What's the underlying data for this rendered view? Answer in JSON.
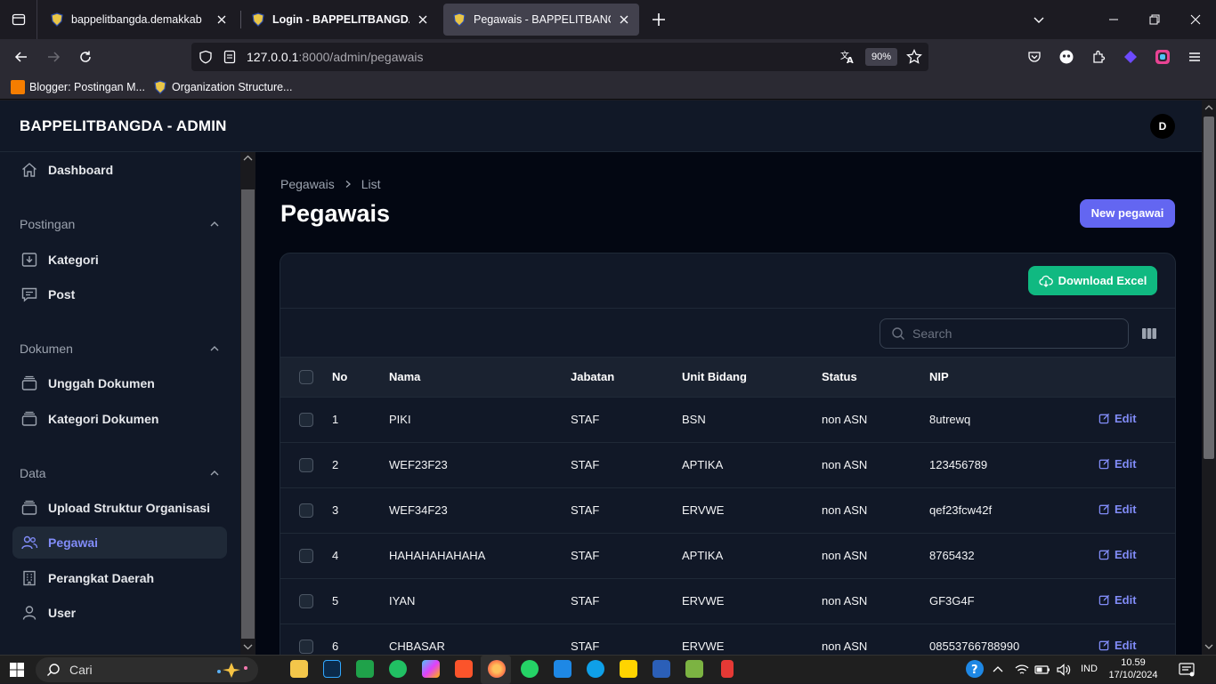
{
  "browser": {
    "tabs": [
      {
        "label": "bappelitbangda.demakkab",
        "active": false
      },
      {
        "label": "Login - BAPPELITBANGDA - AI",
        "active": false
      },
      {
        "label": "Pegawais - BAPPELITBANGDA -",
        "active": true
      }
    ],
    "url_host": "127.0.0.1",
    "url_rest": ":8000/admin/pegawais",
    "zoom": "90%",
    "bookmarks": [
      "Blogger: Postingan M...",
      "Organization Structure..."
    ]
  },
  "app": {
    "brand": "BAPPELITBANGDA - ADMIN",
    "avatar_initial": "D",
    "sidebar": {
      "dashboard": "Dashboard",
      "groups": [
        {
          "label": "Postingan",
          "items": [
            "Kategori",
            "Post"
          ]
        },
        {
          "label": "Dokumen",
          "items": [
            "Unggah Dokumen",
            "Kategori Dokumen"
          ]
        },
        {
          "label": "Data",
          "items": [
            "Upload Struktur Organisasi",
            "Pegawai",
            "Perangkat Daerah",
            "User"
          ]
        }
      ],
      "active_item": "Pegawai"
    },
    "breadcrumb": {
      "parent": "Pegawais",
      "current": "List"
    },
    "title": "Pegawais",
    "new_button": "New pegawai",
    "download_button": "Download Excel",
    "search_placeholder": "Search",
    "table": {
      "columns": [
        "No",
        "Nama",
        "Jabatan",
        "Unit Bidang",
        "Status",
        "NIP"
      ],
      "edit_label": "Edit",
      "rows": [
        {
          "no": "1",
          "nama": "PIKI",
          "jabatan": "STAF",
          "unit": "BSN",
          "status": "non ASN",
          "nip": "8utrewq"
        },
        {
          "no": "2",
          "nama": "WEF23F23",
          "jabatan": "STAF",
          "unit": "APTIKA",
          "status": "non ASN",
          "nip": "123456789"
        },
        {
          "no": "3",
          "nama": "WEF34F23",
          "jabatan": "STAF",
          "unit": "ERVWE",
          "status": "non ASN",
          "nip": "qef23fcw42f"
        },
        {
          "no": "4",
          "nama": "HAHAHAHAHAHA",
          "jabatan": "STAF",
          "unit": "APTIKA",
          "status": "non ASN",
          "nip": "8765432"
        },
        {
          "no": "5",
          "nama": "IYAN",
          "jabatan": "STAF",
          "unit": "ERVWE",
          "status": "non ASN",
          "nip": "GF3G4F"
        },
        {
          "no": "6",
          "nama": "CHBASAR",
          "jabatan": "STAF",
          "unit": "ERVWE",
          "status": "non ASN",
          "nip": "08553766788990"
        }
      ]
    }
  },
  "taskbar": {
    "search_label": "Cari",
    "language": "IND",
    "time": "10.59",
    "date": "17/10/2024"
  },
  "colors": {
    "accent": "#6366f1",
    "success": "#10b981",
    "active_link": "#818cf8"
  }
}
